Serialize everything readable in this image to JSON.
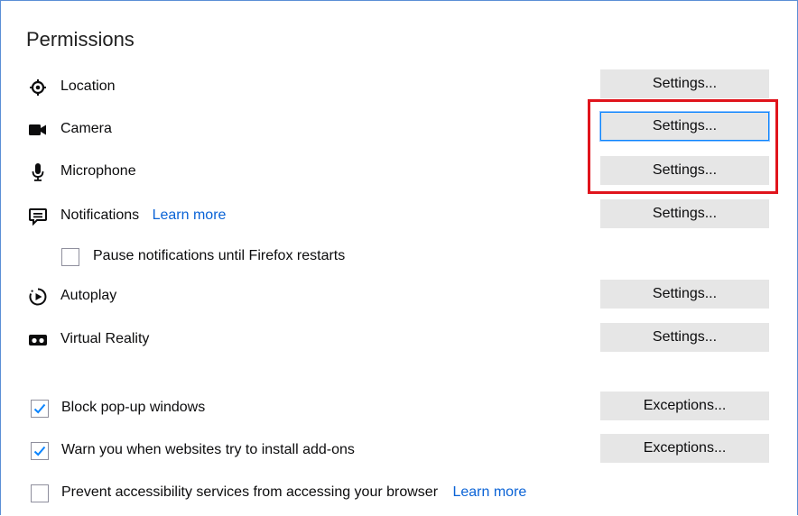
{
  "section_title": "Permissions",
  "permissions": [
    {
      "key": "location",
      "label": "Location",
      "icon": "location-icon",
      "button_label": "Settings..."
    },
    {
      "key": "camera",
      "label": "Camera",
      "icon": "camera-icon",
      "button_label": "Settings..."
    },
    {
      "key": "microphone",
      "label": "Microphone",
      "icon": "microphone-icon",
      "button_label": "Settings..."
    },
    {
      "key": "notifications",
      "label": "Notifications",
      "icon": "notifications-icon",
      "button_label": "Settings...",
      "link": "Learn more"
    },
    {
      "key": "autoplay",
      "label": "Autoplay",
      "icon": "autoplay-icon",
      "button_label": "Settings..."
    },
    {
      "key": "vr",
      "label": "Virtual Reality",
      "icon": "vr-headset-icon",
      "button_label": "Settings..."
    }
  ],
  "pause_notifications": {
    "label": "Pause notifications until Firefox restarts",
    "checked": false
  },
  "block_popups": {
    "label": "Block pop-up windows",
    "checked": true,
    "button_label": "Exceptions..."
  },
  "warn_addons": {
    "label": "Warn you when websites try to install add-ons",
    "checked": true,
    "button_label": "Exceptions..."
  },
  "prevent_accessibility": {
    "label": "Prevent accessibility services from accessing your browser",
    "checked": false,
    "link": "Learn more"
  },
  "colors": {
    "highlight_box": "#e0141c",
    "link": "#0a63d6",
    "focus": "#0a84ff",
    "check": "#0a84ff"
  }
}
